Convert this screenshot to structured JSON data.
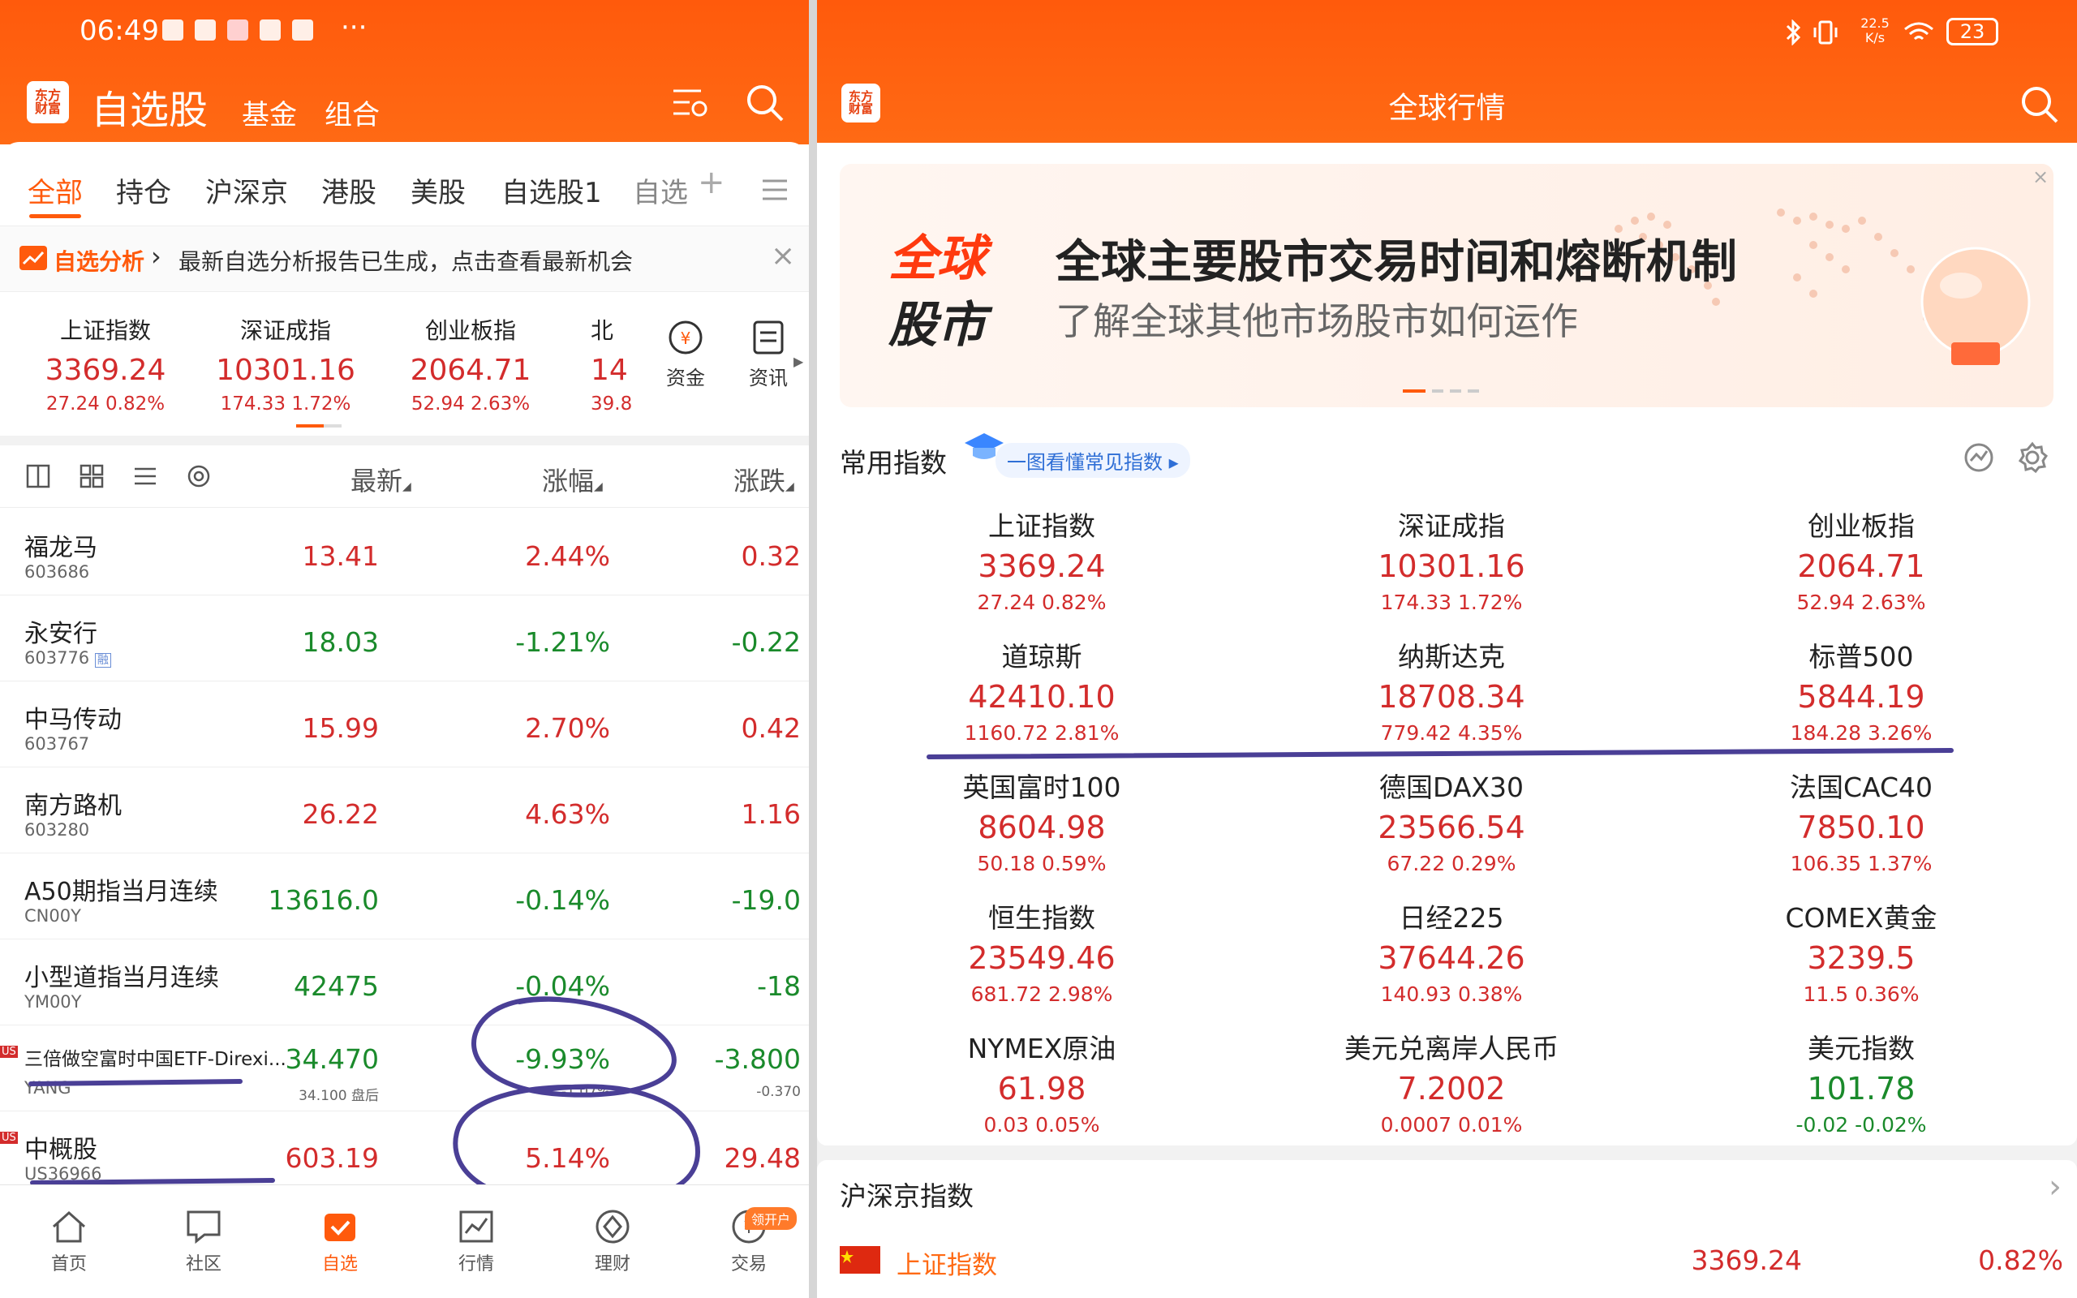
{
  "left": {
    "status": {
      "time": "06:49",
      "more": "···"
    },
    "header": {
      "logo": "东方财富",
      "title": "自选股",
      "tab_fund": "基金",
      "tab_combo": "组合"
    },
    "tabs": [
      "全部",
      "持仓",
      "沪深京",
      "港股",
      "美股",
      "自选股1",
      "自选"
    ],
    "notice": {
      "tag": "自选分析",
      "arrow": "›",
      "text": "最新自选分析报告已生成，点击查看最新机会",
      "close": "×"
    },
    "indices": [
      {
        "name": "上证指数",
        "value": "3369.24",
        "change": "27.24  0.82%"
      },
      {
        "name": "深证成指",
        "value": "10301.16",
        "change": "174.33  1.72%"
      },
      {
        "name": "创业板指",
        "value": "2064.71",
        "change": "52.94  2.63%"
      },
      {
        "name": "北",
        "value": "14",
        "change": "39.8"
      }
    ],
    "shortcuts": {
      "fund": "资金",
      "news": "资讯"
    },
    "list_header": {
      "latest": "最新",
      "pct": "涨幅",
      "chg": "涨跌"
    },
    "rows": [
      {
        "name": "福龙马",
        "code": "603686",
        "price": "13.41",
        "pct": "2.44%",
        "chg": "0.32",
        "color": "red"
      },
      {
        "name": "永安行",
        "code": "603776",
        "price": "18.03",
        "pct": "-1.21%",
        "chg": "-0.22",
        "color": "green",
        "badge": "融"
      },
      {
        "name": "中马传动",
        "code": "603767",
        "price": "15.99",
        "pct": "2.70%",
        "chg": "0.42",
        "color": "red"
      },
      {
        "name": "南方路机",
        "code": "603280",
        "price": "26.22",
        "pct": "4.63%",
        "chg": "1.16",
        "color": "red"
      },
      {
        "name": "A50期指当月连续",
        "code": "CN00Y",
        "price": "13616.0",
        "pct": "-0.14%",
        "chg": "-19.0",
        "color": "green"
      },
      {
        "name": "小型道指当月连续",
        "code": "YM00Y",
        "price": "42475",
        "pct": "-0.04%",
        "chg": "-18",
        "color": "green"
      },
      {
        "name": "三倍做空富时中国ETF-Direxi...",
        "code": "YANG",
        "price": "34.470",
        "pct": "-9.93%",
        "chg": "-3.800",
        "color": "green",
        "us": "US",
        "sub_price": "34.100 盘后",
        "sub_pct": "-1.07%",
        "sub_chg": "-0.370"
      },
      {
        "name": "中概股",
        "code": "US36966",
        "price": "603.19",
        "pct": "5.14%",
        "chg": "29.48",
        "color": "red",
        "us": "US"
      }
    ],
    "nav": [
      "首页",
      "社区",
      "自选",
      "行情",
      "理财",
      "交易"
    ],
    "nav_badge": "领开户"
  },
  "right": {
    "status": {
      "speed": "22.5 K/s",
      "battery": "23"
    },
    "header": {
      "logo": "东方财富",
      "title": "全球行情"
    },
    "banner": {
      "tag1": "全球",
      "tag2": "股市",
      "title": "全球主要股市交易时间和熔断机制",
      "subtitle": "了解全球其他市场股市如何运作",
      "close": "×"
    },
    "common": {
      "title": "常用指数",
      "link": "一图看懂常见指数 ▸"
    },
    "grid": [
      {
        "name": "上证指数",
        "value": "3369.24",
        "change": "27.24  0.82%",
        "color": "red"
      },
      {
        "name": "深证成指",
        "value": "10301.16",
        "change": "174.33  1.72%",
        "color": "red"
      },
      {
        "name": "创业板指",
        "value": "2064.71",
        "change": "52.94  2.63%",
        "color": "red"
      },
      {
        "name": "道琼斯",
        "value": "42410.10",
        "change": "1160.72  2.81%",
        "color": "red"
      },
      {
        "name": "纳斯达克",
        "value": "18708.34",
        "change": "779.42  4.35%",
        "color": "red"
      },
      {
        "name": "标普500",
        "value": "5844.19",
        "change": "184.28  3.26%",
        "color": "red"
      },
      {
        "name": "英国富时100",
        "value": "8604.98",
        "change": "50.18  0.59%",
        "color": "red"
      },
      {
        "name": "德国DAX30",
        "value": "23566.54",
        "change": "67.22  0.29%",
        "color": "red"
      },
      {
        "name": "法国CAC40",
        "value": "7850.10",
        "change": "106.35  1.37%",
        "color": "red"
      },
      {
        "name": "恒生指数",
        "value": "23549.46",
        "change": "681.72  2.98%",
        "color": "red"
      },
      {
        "name": "日经225",
        "value": "37644.26",
        "change": "140.93  0.38%",
        "color": "red"
      },
      {
        "name": "COMEX黄金",
        "value": "3239.5",
        "change": "11.5  0.36%",
        "color": "red"
      },
      {
        "name": "NYMEX原油",
        "value": "61.98",
        "change": "0.03  0.05%",
        "color": "red"
      },
      {
        "name": "美元兑离岸人民币",
        "value": "7.2002",
        "change": "0.0007  0.01%",
        "color": "red"
      },
      {
        "name": "美元指数",
        "value": "101.78",
        "change": "-0.02  -0.02%",
        "color": "green"
      }
    ],
    "hs": {
      "title": "沪深京指数",
      "arrow": "›",
      "row_name": "上证指数",
      "row_value": "3369.24",
      "row_pct": "0.82%"
    }
  },
  "colors": {
    "orange": "#ff5a0c",
    "red": "#d32c2c",
    "green": "#1a8a2b",
    "annotation": "#4a3f96"
  }
}
